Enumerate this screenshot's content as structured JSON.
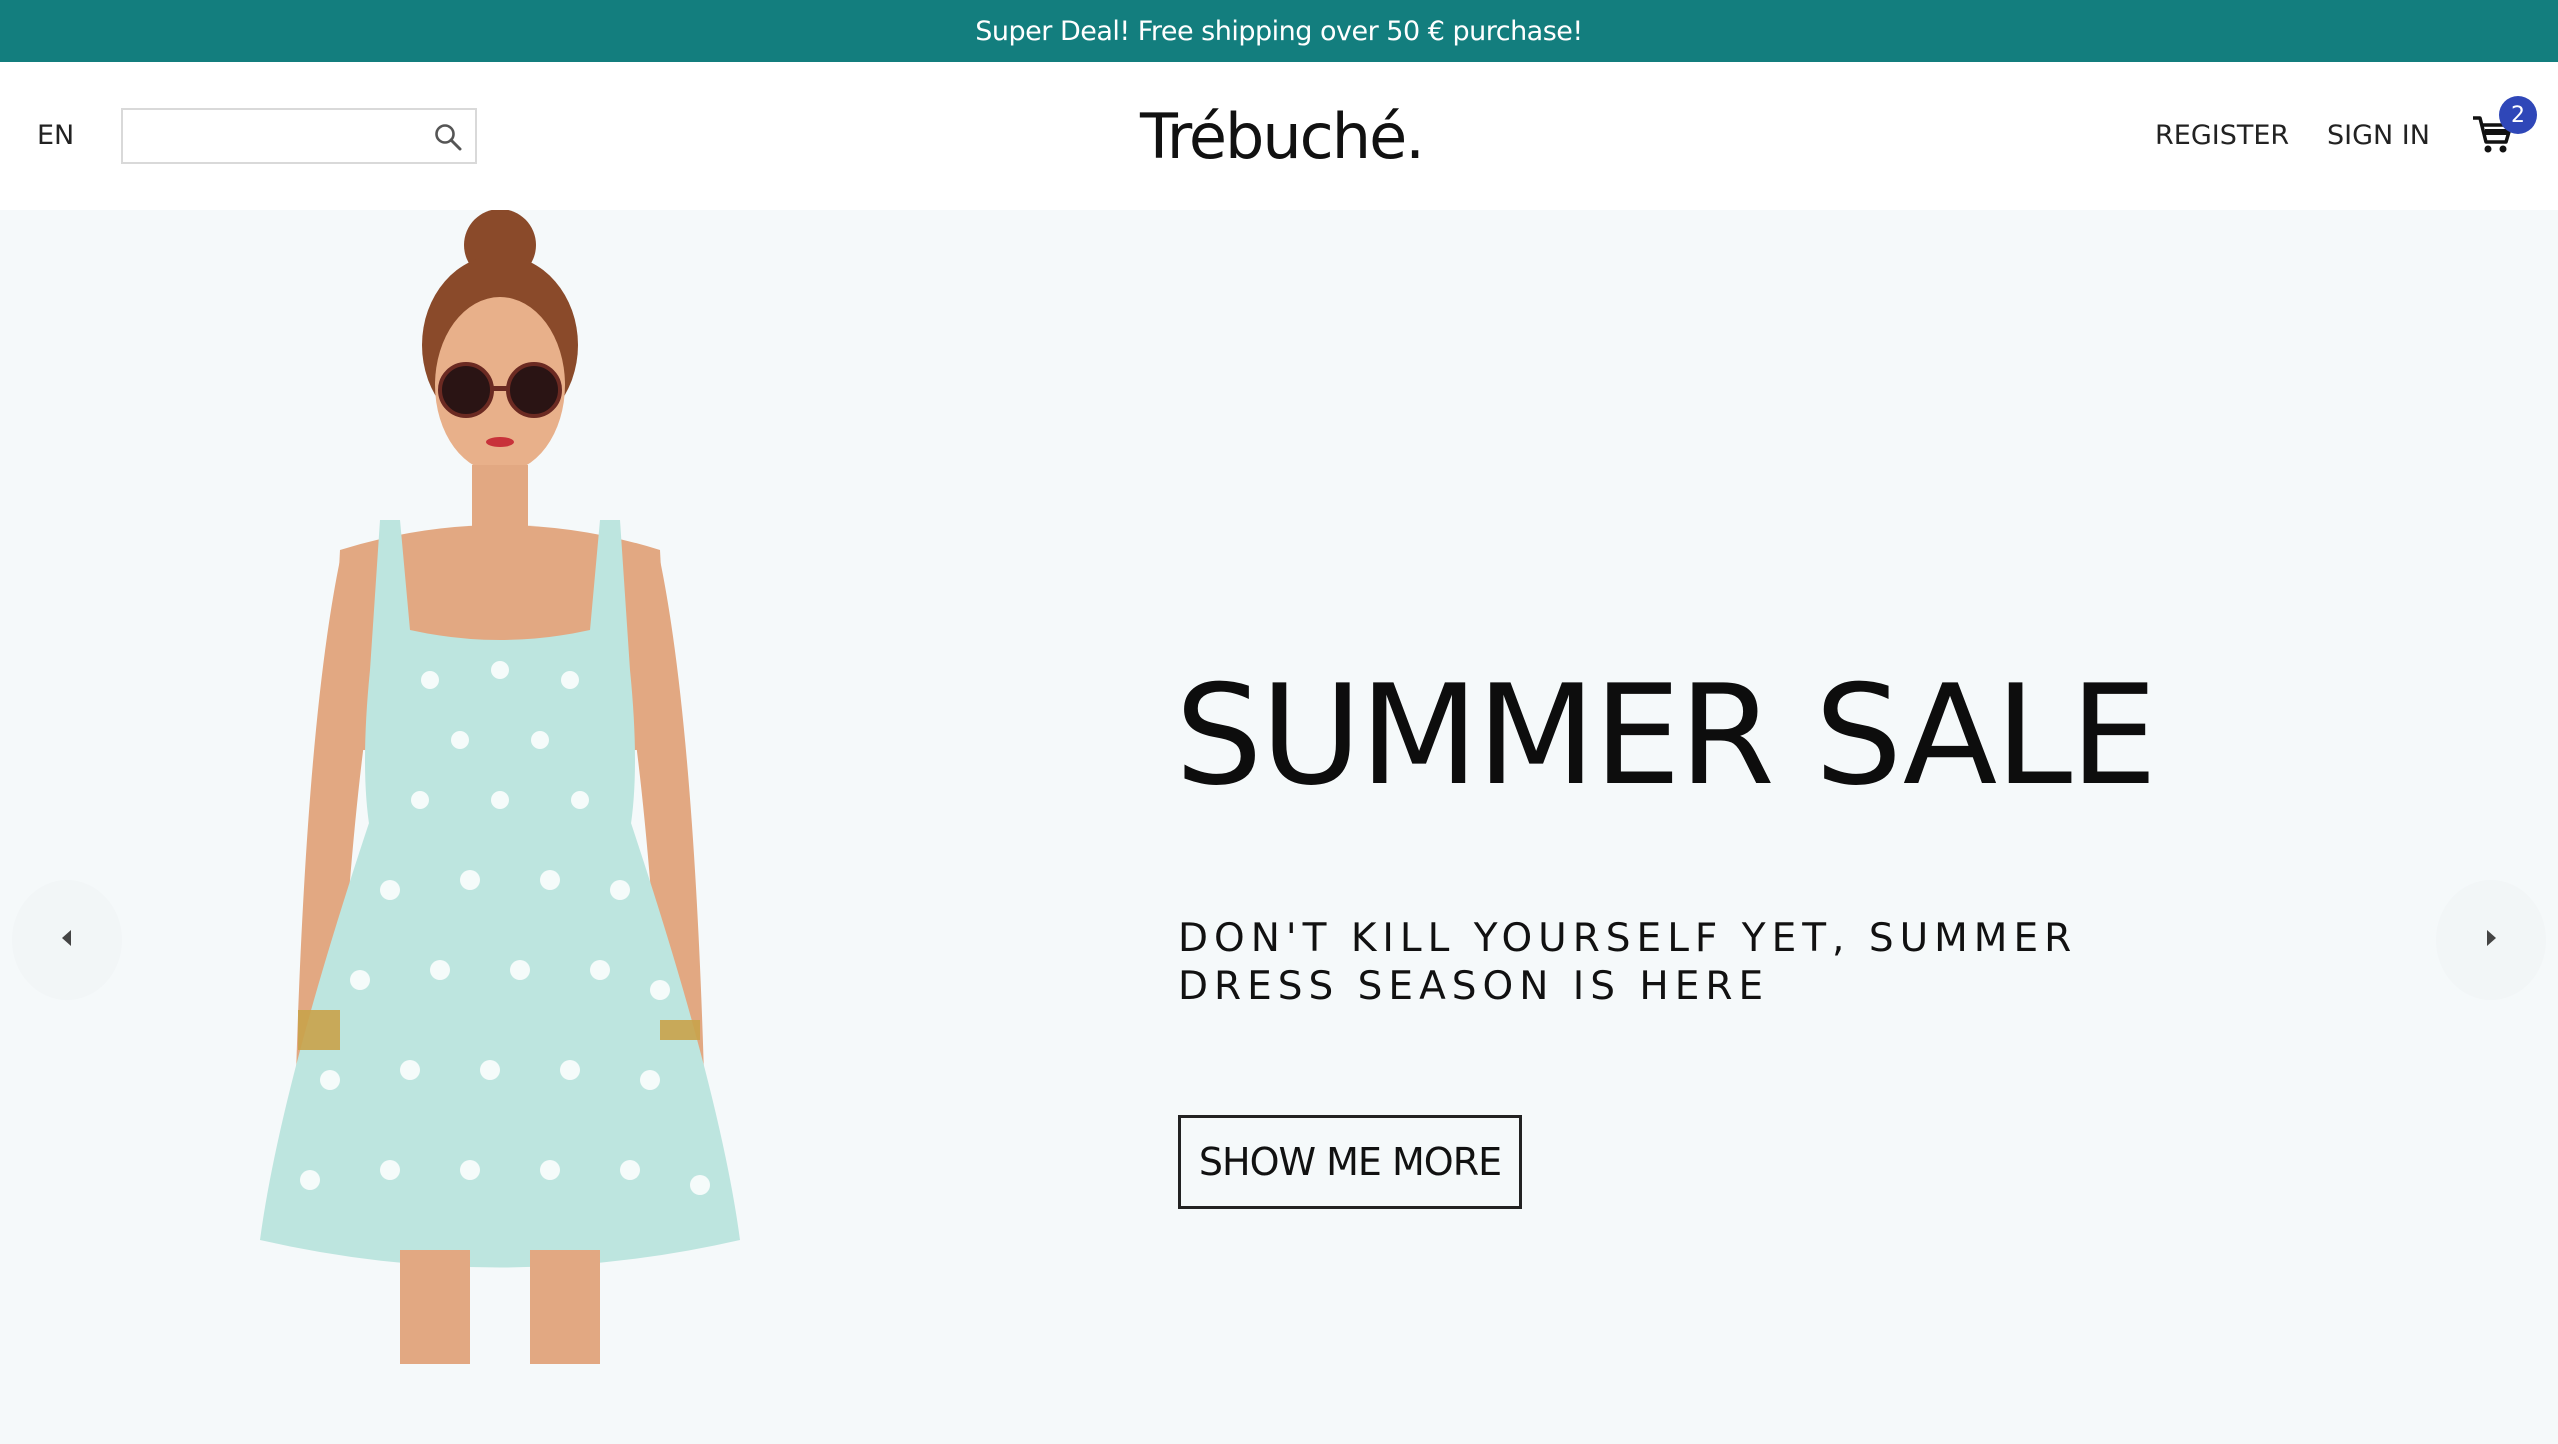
{
  "promo": {
    "text": "Super Deal! Free shipping over 50 € purchase!",
    "background": "#137e7e"
  },
  "header": {
    "language": "EN",
    "search": {
      "value": "",
      "placeholder": ""
    },
    "logo": "Trébuché.",
    "register": "REGISTER",
    "sign_in": "SIGN IN",
    "cart_count": "2",
    "cart_badge_color": "#2f47b8"
  },
  "hero": {
    "title": "SUMMER SALE",
    "subtitle": "DON'T KILL YOURSELF YET, SUMMER DRESS SEASON IS HERE",
    "cta": "SHOW ME MORE",
    "background": "#f5f9fa"
  },
  "icons": [
    "search-icon",
    "cart-icon",
    "caret-left-icon",
    "caret-right-icon"
  ]
}
